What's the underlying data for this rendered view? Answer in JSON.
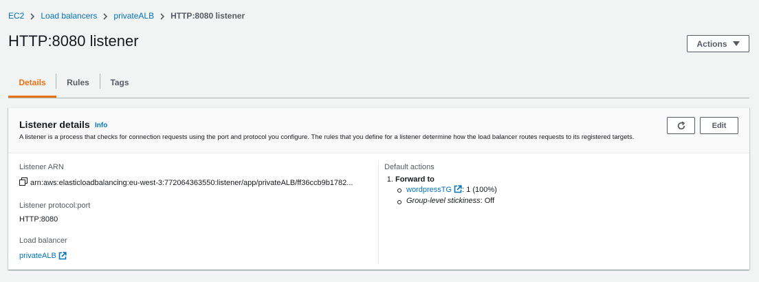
{
  "breadcrumb": {
    "items": [
      "EC2",
      "Load balancers",
      "privateALB"
    ],
    "current": "HTTP:8080 listener"
  },
  "page": {
    "title": "HTTP:8080 listener",
    "actions_label": "Actions"
  },
  "tabs": [
    "Details",
    "Rules",
    "Tags"
  ],
  "panel": {
    "title": "Listener details",
    "info_label": "Info",
    "description": "A listener is a process that checks for connection requests using the port and protocol you configure. The rules that you define for a listener determine how the load balancer routes requests to its registered targets.",
    "edit_label": "Edit"
  },
  "fields": {
    "arn_label": "Listener ARN",
    "arn_value": "arn:aws:elasticloadbalancing:eu-west-3:772064363550:listener/app/privateALB/ff36ccb9b1782...",
    "protocol_label": "Listener protocol:port",
    "protocol_value": "HTTP:8080",
    "lb_label": "Load balancer",
    "lb_value": "privateALB"
  },
  "default_actions": {
    "label": "Default actions",
    "forward_to": "Forward to",
    "target_group": "wordpressTG",
    "target_weight": ": 1 (100%)",
    "stickiness_label": "Group-level stickiness",
    "stickiness_value": ": Off"
  },
  "colors": {
    "accent": "#ec7211",
    "link": "#0073bb",
    "background": "#f2f3f3"
  }
}
